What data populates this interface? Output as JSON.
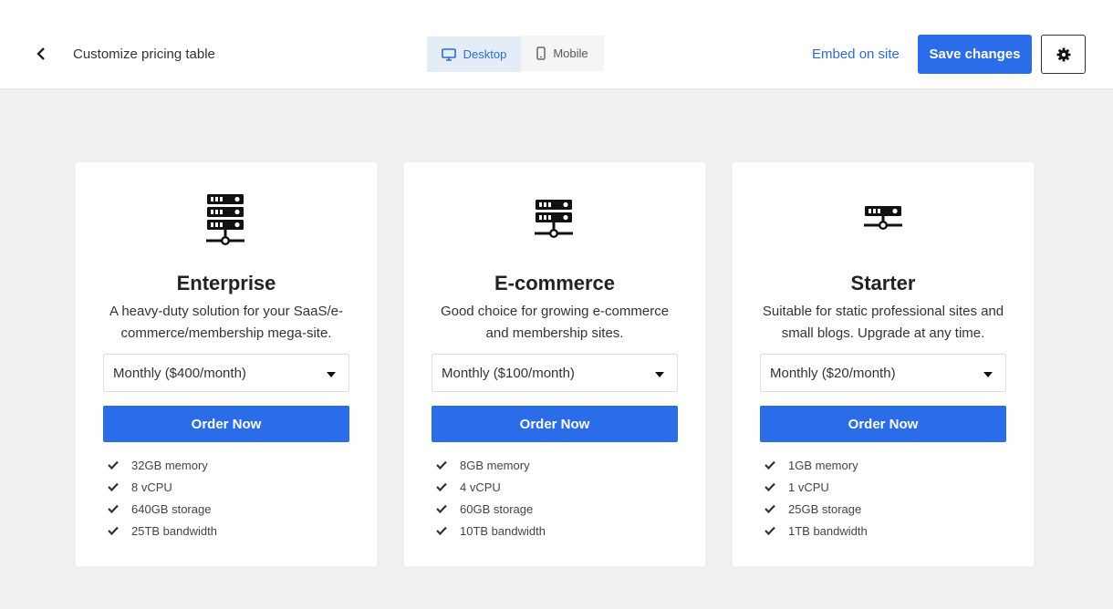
{
  "header": {
    "title": "Customize pricing table",
    "back_icon": "chevron-left-icon",
    "device_toggle": [
      {
        "label": "Desktop",
        "icon": "desktop-icon",
        "active": true
      },
      {
        "label": "Mobile",
        "icon": "mobile-icon",
        "active": false
      }
    ],
    "embed_label": "Embed on site",
    "save_label": "Save changes",
    "settings_icon": "gear-icon"
  },
  "colors": {
    "accent": "#2b6de8",
    "link": "#2b6bd6",
    "background": "#f0f0f0"
  },
  "plans": [
    {
      "name": "Enterprise",
      "icon": "server-rack-large-icon",
      "description": "A heavy-duty solution for your SaaS/e-commerce/membership mega-site.",
      "billing": "Monthly ($400/month)",
      "cta": "Order Now",
      "features": [
        "32GB memory",
        "8 vCPU",
        "640GB storage",
        "25TB bandwidth"
      ]
    },
    {
      "name": "E-commerce",
      "icon": "server-rack-medium-icon",
      "description": "Good choice for growing e-commerce and membership sites.",
      "billing": "Monthly ($100/month)",
      "cta": "Order Now",
      "features": [
        "8GB memory",
        "4 vCPU",
        "60GB storage",
        "10TB bandwidth"
      ]
    },
    {
      "name": "Starter",
      "icon": "server-small-icon",
      "description": "Suitable for static professional sites and small blogs. Upgrade at any time.",
      "billing": "Monthly ($20/month)",
      "cta": "Order Now",
      "features": [
        "1GB memory",
        "1 vCPU",
        "25GB storage",
        "1TB bandwidth"
      ]
    }
  ]
}
